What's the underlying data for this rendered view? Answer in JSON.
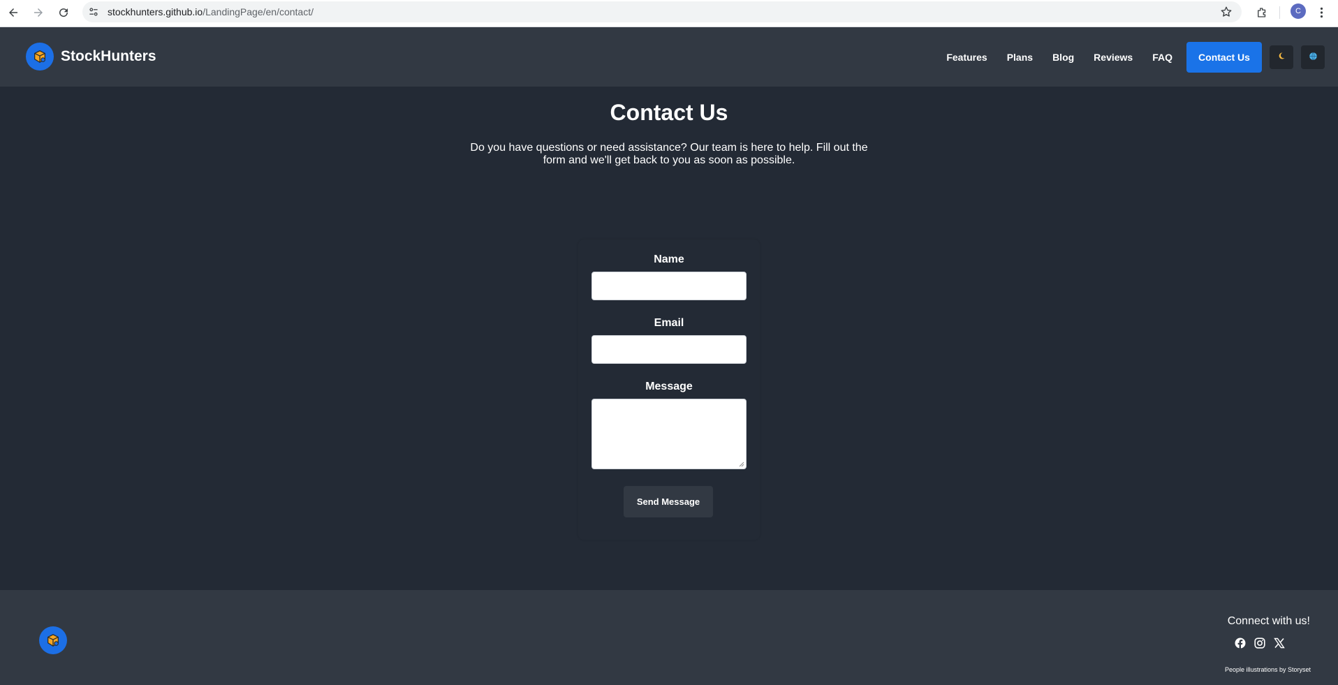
{
  "browser": {
    "url_domain": "stockhunters.github.io",
    "url_path": "/LandingPage/en/contact/",
    "profile_initial": "C"
  },
  "header": {
    "brand_name": "StockHunters",
    "nav": [
      {
        "label": "Features"
      },
      {
        "label": "Plans"
      },
      {
        "label": "Blog"
      },
      {
        "label": "Reviews"
      },
      {
        "label": "FAQ"
      }
    ],
    "contact_label": "Contact Us",
    "theme_icon": "moon-icon",
    "language_icon": "globe-icon"
  },
  "main": {
    "title": "Contact Us",
    "intro": "Do you have questions or need assistance? Our team is here to help. Fill out the form and we'll get back to you as soon as possible."
  },
  "form": {
    "name_label": "Name",
    "name_value": "",
    "email_label": "Email",
    "email_value": "",
    "message_label": "Message",
    "message_value": "",
    "send_label": "Send Message"
  },
  "footer": {
    "connect": "Connect with us!",
    "socials": [
      "facebook-icon",
      "instagram-icon",
      "x-icon"
    ],
    "credit": "People illustrations by Storyset"
  },
  "colors": {
    "page_bg": "#232a35",
    "header_bg": "#323943",
    "accent": "#1a73e8",
    "logo_bg": "#1c6fe6",
    "logo_box": "#f5a623"
  }
}
